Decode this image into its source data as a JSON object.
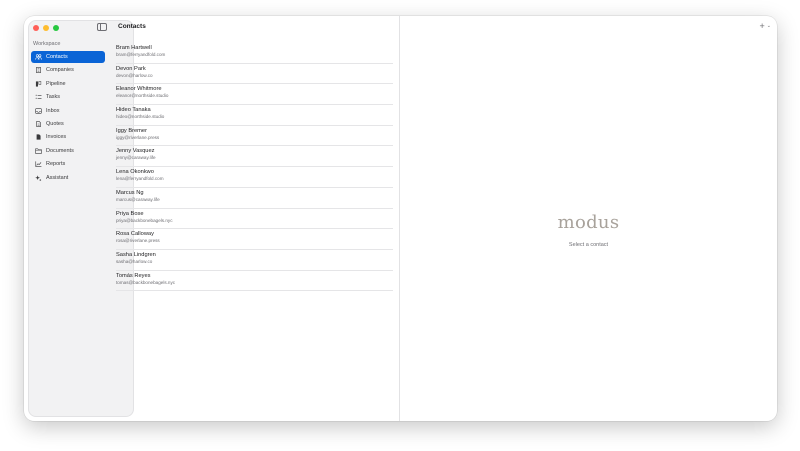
{
  "window": {
    "title": "Contacts"
  },
  "sidebar": {
    "section_label": "Workspace",
    "items": [
      {
        "label": "Contacts",
        "icon": "people-icon",
        "active": true
      },
      {
        "label": "Companies",
        "icon": "building-icon"
      },
      {
        "label": "Pipeline",
        "icon": "pipeline-icon"
      },
      {
        "label": "Tasks",
        "icon": "checklist-icon"
      },
      {
        "label": "Inbox",
        "icon": "inbox-icon"
      },
      {
        "label": "Quotes",
        "icon": "document-icon"
      },
      {
        "label": "Invoices",
        "icon": "invoice-icon"
      },
      {
        "label": "Documents",
        "icon": "folder-icon"
      },
      {
        "label": "Reports",
        "icon": "chart-icon"
      },
      {
        "label": "Assistant",
        "icon": "sparkle-icon"
      }
    ]
  },
  "toolbar": {
    "add_symbol": "+",
    "chevron": "⌄"
  },
  "contacts": [
    {
      "name": "Bram Hartwell",
      "email": "bram@ferryandfold.com"
    },
    {
      "name": "Devon Park",
      "email": "devon@harlow.co"
    },
    {
      "name": "Eleanor Whitmore",
      "email": "eleanor@northside.studio"
    },
    {
      "name": "Hideo Tanaka",
      "email": "hideo@northside.studio"
    },
    {
      "name": "Iggy Bremer",
      "email": "iggy@riverlane.press"
    },
    {
      "name": "Jenny Vasquez",
      "email": "jenny@caraway.life"
    },
    {
      "name": "Lena Okonkwo",
      "email": "lena@ferryandfold.com"
    },
    {
      "name": "Marcus Ng",
      "email": "marcus@caraway.life"
    },
    {
      "name": "Priya Bose",
      "email": "priya@backbonebagels.nyc"
    },
    {
      "name": "Rosa Calloway",
      "email": "rosa@riverlane.press"
    },
    {
      "name": "Sasha Lindgren",
      "email": "sasha@harlow.co"
    },
    {
      "name": "Tomás Reyes",
      "email": "tomas@backbonebagels.nyc"
    }
  ],
  "detail": {
    "logo": "modus",
    "empty_message": "Select a contact"
  },
  "colors": {
    "accent": "#0a64d6",
    "sidebar_bg": "#f2f2f3",
    "logo": "#a8a29b"
  }
}
